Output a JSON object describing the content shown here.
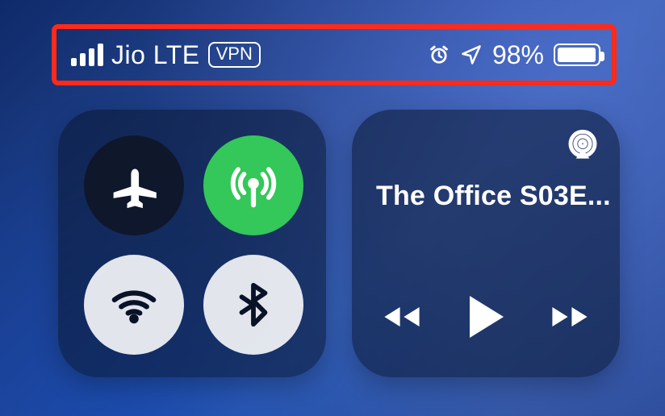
{
  "status": {
    "carrier": "Jio LTE",
    "vpn_label": "VPN",
    "battery_percent_text": "98%",
    "battery_percent": 98
  },
  "connectivity": {
    "airplane_on": false,
    "cellular_on": true,
    "wifi_on": false,
    "bluetooth_on": false
  },
  "media": {
    "now_playing_title": "The Office S03E..."
  }
}
